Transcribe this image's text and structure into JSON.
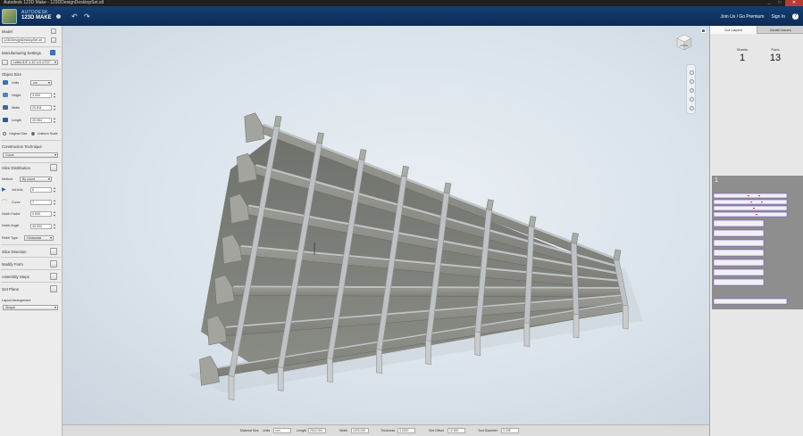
{
  "window": {
    "title": "Autodesk 123D Make - 123DDesignDesktopSet.stl",
    "controls": [
      "_",
      "□",
      "✕"
    ]
  },
  "header": {
    "brand_line1": "AUTODESK",
    "brand_line2": "123D  MAKE",
    "join_label": "Join Us / Go Premium",
    "signin_label": "Sign In",
    "help_label": "?",
    "undo_icon": "undo-arrow-icon",
    "redo_icon": "redo-arrow-icon"
  },
  "left": {
    "model": {
      "title": "Model",
      "file": "123DDesignDesktopSet.stl"
    },
    "manufacturing": {
      "title": "Manufacturing Settings",
      "sheet": "Letter 8.5\" x 11\" x 0.1772\""
    },
    "object_size": {
      "title": "Object Size",
      "units_label": "Units",
      "units_value": "cm",
      "height_label": "Height",
      "height_value": "3.000",
      "width_label": "Width",
      "width_value": "20.811",
      "length_label": "Length",
      "length_value": "20.954",
      "original_size": "Original Size",
      "uniform_scale": "Uniform Scale"
    },
    "construction": {
      "title": "Construction Technique",
      "value": "Curve"
    },
    "slice": {
      "title": "Slice Distribution",
      "method_label": "Method",
      "method_value": "By count",
      "first_axis_label": "1st Axis",
      "first_axis_value": "8",
      "curve_label": "Curve",
      "curve_value": "7",
      "notch_factor_label": "Notch Factor",
      "notch_factor_value": "0.500",
      "notch_angle_label": "Notch Angle",
      "notch_angle_value": "45.000",
      "relief_label": "Relief Type",
      "relief_value": "Horizontal"
    },
    "slice_direction": "Slice Direction",
    "modify_form": "Modify Form",
    "assembly_steps": "Assembly Steps",
    "get_plans": "Get Plans",
    "layout": {
      "title": "Layout Arrangement",
      "value": "Simple"
    }
  },
  "bottom": {
    "material_size": "Material Size",
    "units_label": "Units",
    "units_value": "mm",
    "length_label": "Length",
    "length_value": "2540.000",
    "width_label": "Width",
    "width_value": "1403.000",
    "thickness_label": "Thickness",
    "thickness_value": "3.0000",
    "slot_offset_label": "Slot Offset",
    "slot_offset_value": "12.500",
    "tool_diameter_label": "Tool Diameter",
    "tool_diameter_value": "3.048"
  },
  "right": {
    "tab_cut": "Cut Layout",
    "tab_issues": "Model Issues",
    "sheets_label": "Sheets",
    "sheets_value": "1",
    "parts_label": "Parts",
    "parts_value": "13",
    "sheet_number": "1"
  },
  "viewcube_label": "FRONT",
  "colors": {
    "header": "#143e73",
    "panel": "#ececec",
    "viewport": "#d9e2ea",
    "slab_face": "#8d8d86",
    "slab_edge": "#bfc2c4",
    "part_outline": "#7b5cc9",
    "part_label": "#d94070"
  }
}
